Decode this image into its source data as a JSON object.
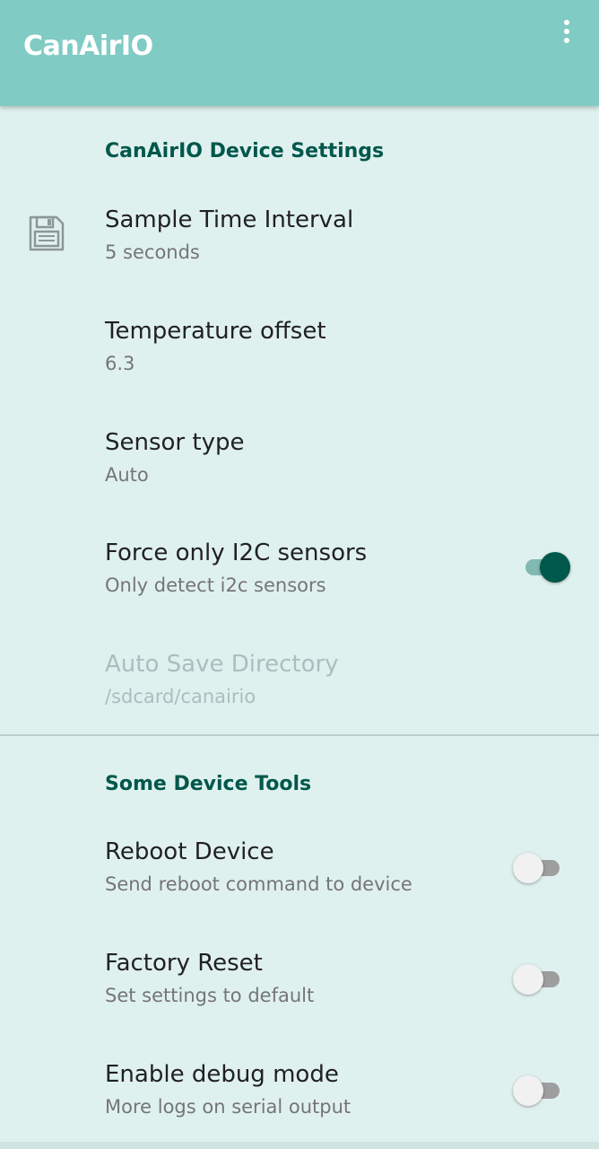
{
  "app_bar": {
    "title": "CanAirIO",
    "overflow_icon": "more-vert-icon"
  },
  "device_settings": {
    "category_title": "CanAirIO Device Settings",
    "items": [
      {
        "title": "Sample Time Interval",
        "summary": "5 seconds",
        "icon": "save-icon"
      },
      {
        "title": "Temperature offset",
        "summary": "6.3"
      },
      {
        "title": "Sensor type",
        "summary": "Auto"
      },
      {
        "title": "Force only I2C sensors",
        "summary": "Only detect i2c sensors",
        "switch_on": true
      },
      {
        "title": "Auto Save Directory",
        "summary": "/sdcard/canairio",
        "disabled": true
      }
    ]
  },
  "device_tools": {
    "category_title": "Some Device Tools",
    "items": [
      {
        "title": "Reboot Device",
        "summary": "Send reboot command to device",
        "switch_on": false
      },
      {
        "title": "Factory Reset",
        "summary": "Set settings to default",
        "switch_on": false
      },
      {
        "title": "Enable debug mode",
        "summary": "More logs on serial output",
        "switch_on": false
      }
    ]
  },
  "colors": {
    "app_bar": "#80cbc4",
    "background": "#dff1ef",
    "accent": "#00574b"
  }
}
